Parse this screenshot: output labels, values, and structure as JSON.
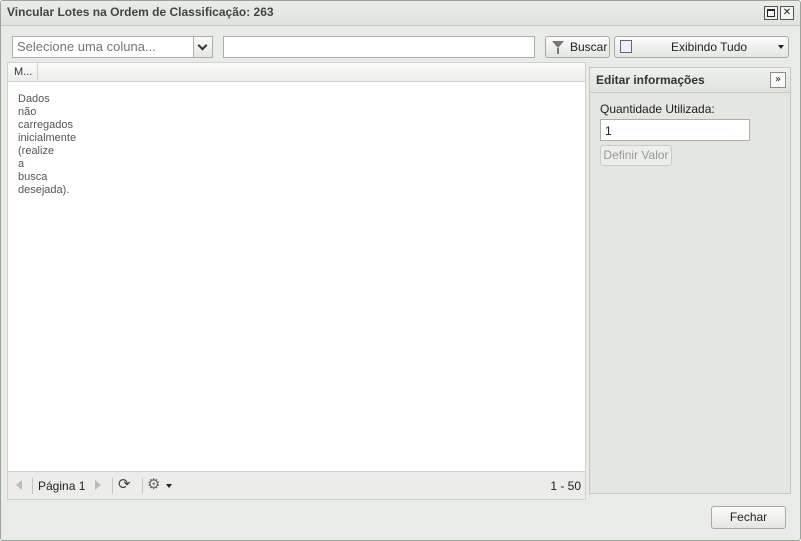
{
  "window": {
    "title": "Vincular Lotes na Ordem de Classificação: 263"
  },
  "toolbar": {
    "column_select_placeholder": "Selecione uma coluna...",
    "search_value": "",
    "search_button": "Buscar",
    "filter_dropdown": "Exibindo Tudo"
  },
  "grid": {
    "column_header": "M...",
    "empty_message": "Dados não carregados inicialmente (realize a busca desejada)."
  },
  "pager": {
    "page_label": "Página 1",
    "range": "1 - 50"
  },
  "panel": {
    "title": "Editar informações",
    "quantity_label": "Quantidade Utilizada:",
    "quantity_value": "1",
    "set_value_button": "Definir Valor"
  },
  "footer": {
    "close_button": "Fechar"
  }
}
